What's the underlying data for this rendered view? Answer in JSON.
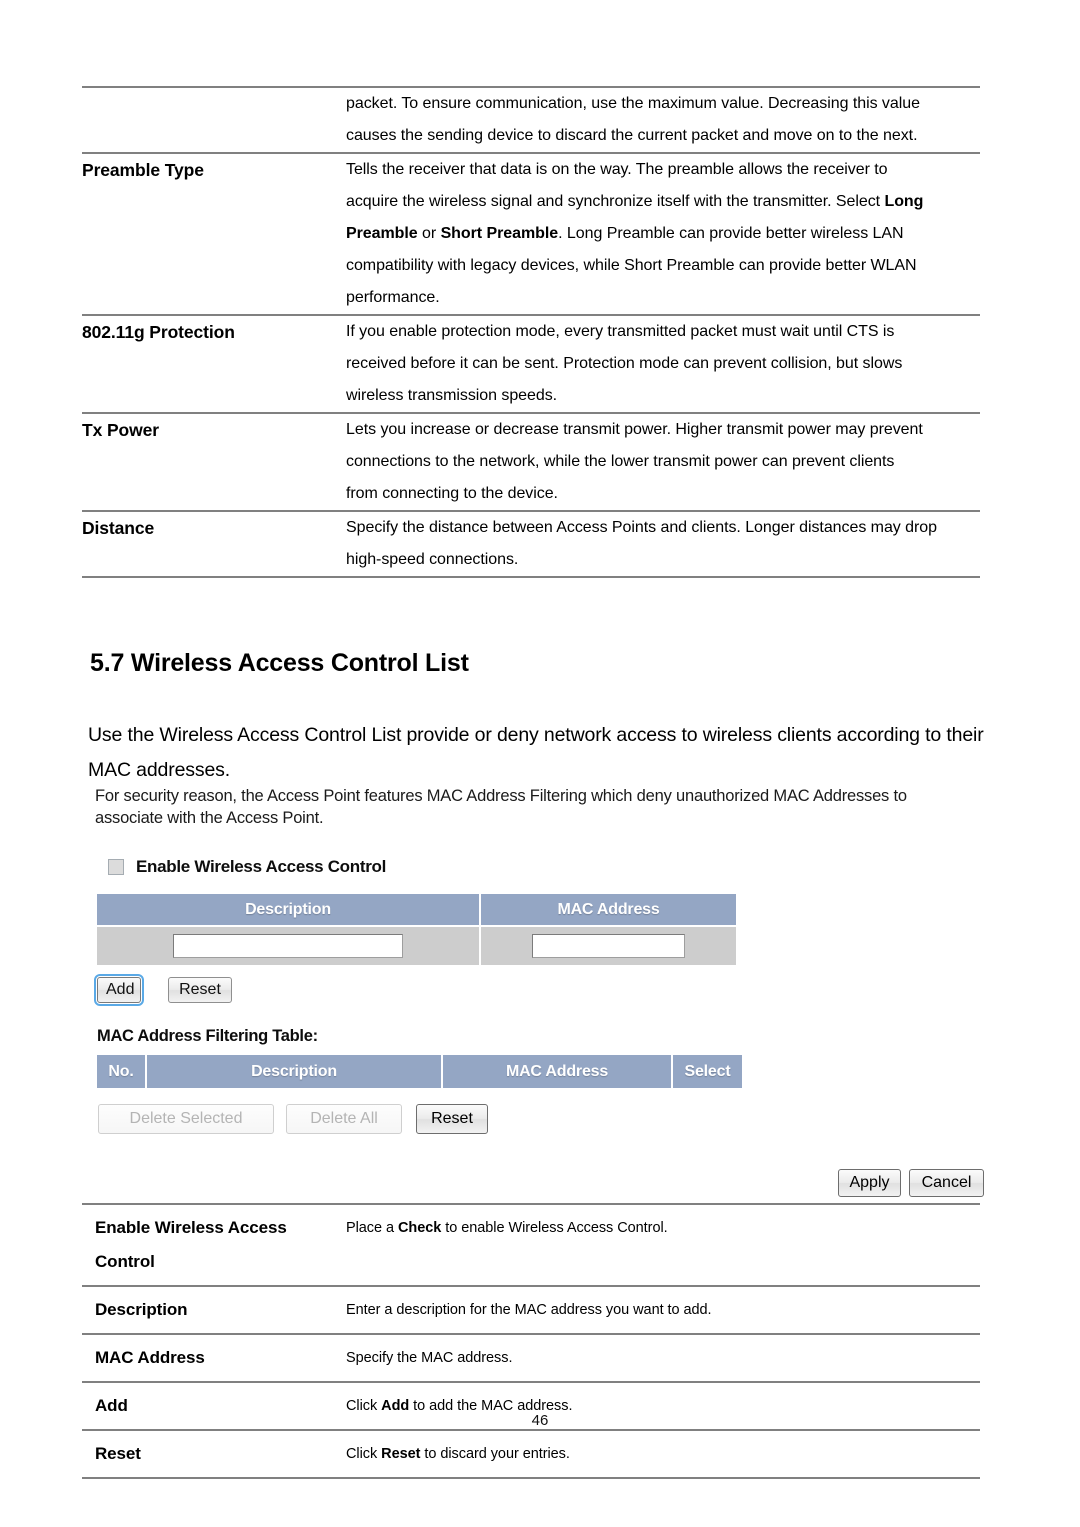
{
  "document": {
    "page_number": "46"
  },
  "top_table": {
    "rows": [
      {
        "term": "",
        "definition_lines": [
          "packet. To ensure communication, use the maximum value. Decreasing this value",
          "causes the sending device to discard the current packet and move on to the next."
        ]
      },
      {
        "term": "Preamble Type",
        "definition_lines": [
          "Tells the receiver that data is on the way. The preamble allows the receiver to",
          "acquire the wireless signal and synchronize itself with the transmitter. Select Long",
          "Preamble or Short Preamble. Long Preamble can provide better wireless LAN",
          "compatibility with legacy devices, while Short Preamble can provide better WLAN",
          "performance."
        ]
      },
      {
        "term": "802.11g Protection",
        "definition_lines": [
          "If you enable protection mode, every transmitted packet must wait until CTS is",
          "received before it can be sent. Protection mode can prevent collision, but slows",
          "wireless transmission speeds."
        ]
      },
      {
        "term": "Tx Power",
        "definition_lines": [
          "Lets you increase or decrease transmit power. Higher transmit power may prevent",
          "connections to the network, while the lower transmit power can prevent clients",
          "from connecting to the device."
        ]
      },
      {
        "term": "Distance",
        "definition_lines": [
          "Specify the distance between Access Points and clients. Longer distances may drop",
          "high-speed connections."
        ]
      }
    ]
  },
  "section": {
    "heading": "5.7 Wireless Access Control List",
    "intro": "Use the Wireless Access Control List provide or deny network access to wireless clients according to their MAC addresses.",
    "note": "For security reason, the Access Point features MAC Address Filtering which deny unauthorized MAC Addresses to associate with the Access Point."
  },
  "router_ui": {
    "enable_checkbox_label": "Enable Wireless Access Control",
    "enable_checkbox_checked": false,
    "entry_table": {
      "headers": [
        "Description",
        "MAC Address"
      ],
      "description_value": "",
      "description_placeholder": "",
      "mac_value": "",
      "mac_placeholder": ""
    },
    "add_button": "Add",
    "reset_button": "Reset",
    "filter_table_title": "MAC Address Filtering Table:",
    "filter_table": {
      "headers": [
        "No.",
        "Description",
        "MAC Address",
        "Select"
      ],
      "rows": []
    },
    "delete_selected_button": "Delete Selected",
    "delete_all_button": "Delete All",
    "reset_button_2": "Reset",
    "apply_button": "Apply",
    "cancel_button": "Cancel"
  },
  "bottom_table": {
    "rows": [
      {
        "term": "Enable Wireless Access Control",
        "definition_pre": "Place a ",
        "definition_bold": "Check",
        "definition_post": " to enable Wireless Access Control."
      },
      {
        "term": "Description",
        "definition_pre": "Enter a description for the MAC address you want to add.",
        "definition_bold": "",
        "definition_post": ""
      },
      {
        "term": "MAC Address",
        "definition_pre": "Specify the MAC address.",
        "definition_bold": "",
        "definition_post": ""
      },
      {
        "term": "Add",
        "definition_pre": "Click ",
        "definition_bold": "Add",
        "definition_post": " to add the MAC address."
      },
      {
        "term": "Reset",
        "definition_pre": "Click ",
        "definition_bold": "Reset",
        "definition_post": " to discard your entries."
      }
    ]
  },
  "colors": {
    "table_header_blue": "#94a6c4",
    "table_cell_gray": "#cdcdcd",
    "rule_gray": "#808080",
    "focus_blue": "#5aa9e6"
  }
}
